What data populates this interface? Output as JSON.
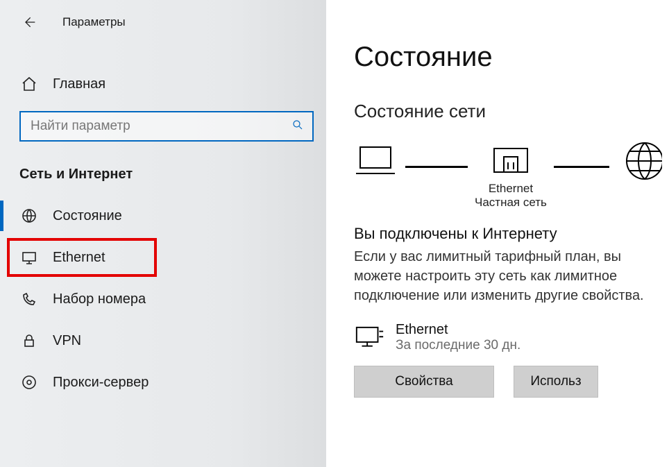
{
  "titlebar": {
    "title": "Параметры"
  },
  "sidebar": {
    "home_label": "Главная",
    "search_placeholder": "Найти параметр",
    "section_title": "Сеть и Интернет",
    "items": [
      {
        "label": "Состояние"
      },
      {
        "label": "Ethernet"
      },
      {
        "label": "Набор номера"
      },
      {
        "label": "VPN"
      },
      {
        "label": "Прокси-сервер"
      }
    ]
  },
  "main": {
    "page_title": "Состояние",
    "subtitle": "Состояние сети",
    "diagram": {
      "router_label_1": "Ethernet",
      "router_label_2": "Частная сеть"
    },
    "connected_heading": "Вы подключены к Интернету",
    "connected_text": "Если у вас лимитный тарифный план, вы можете настроить эту сеть как лимитное подключение или изменить другие свойства.",
    "connection": {
      "name": "Ethernet",
      "sub": "За последние 30 дн."
    },
    "buttons": {
      "properties": "Свойства",
      "usage": "Использ"
    }
  }
}
